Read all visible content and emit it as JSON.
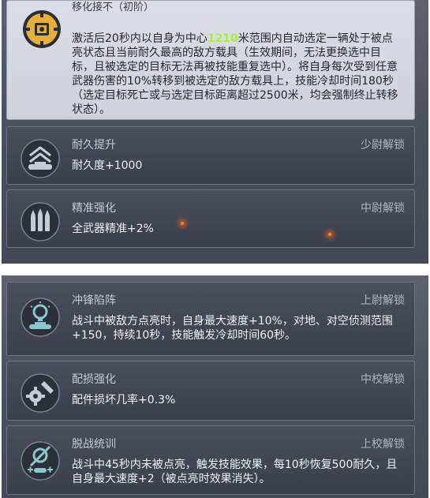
{
  "panel_top": {
    "featured": {
      "title": "移化接不（初阶）",
      "desc_before": "激活后20秒内以自身为中心",
      "desc_highlight": "1210",
      "desc_after": "米范围内自动选定一辆处于被点亮状态且当前耐久最高的敌方载具（生效期间，无法更换选中目标，且被选定的目标无法再被技能重复选中）。将自身每次受到任意武器伤害的10%转移到被选定的敌方载具上，技能冷却时间180秒（选定目标死亡或与选定目标距离超过2500米，均会强制终止转移状态）。",
      "icon": "gear-transfer-icon"
    },
    "skills": [
      {
        "title": "耐久提升",
        "badge": "少尉解锁",
        "desc": "耐久度+1000",
        "icon": "armor-up-icon"
      },
      {
        "title": "精准强化",
        "badge": "中尉解锁",
        "desc": "全武器精准+2%",
        "icon": "ammo-precision-icon"
      }
    ]
  },
  "panel_bottom": {
    "skills": [
      {
        "title": "冲锋陷阵",
        "badge": "上尉解锁",
        "desc": "战斗中被敌方点亮时，自身最大速度+10%，对地、对空侦测范围+150，持续10秒，技能触发冷却时间60秒。",
        "icon": "lightbulb-tank-icon"
      },
      {
        "title": "配损强化",
        "badge": "中校解锁",
        "desc": "配件损坏几率+0.3%",
        "icon": "gear-repair-icon"
      },
      {
        "title": "脱战统训",
        "badge": "上校解锁",
        "desc": "战斗中45秒内未被点亮，触发技能效果，每10秒恢复500耐久，且自身最大速度+2（被点亮时效果消失）。",
        "icon": "stealth-tank-icon"
      }
    ]
  },
  "colors": {
    "highlight": "#a3f03a",
    "icon_gold": "#e3b13a",
    "icon_teal": "#8ec6cf",
    "icon_gray": "#c7cbd3"
  }
}
